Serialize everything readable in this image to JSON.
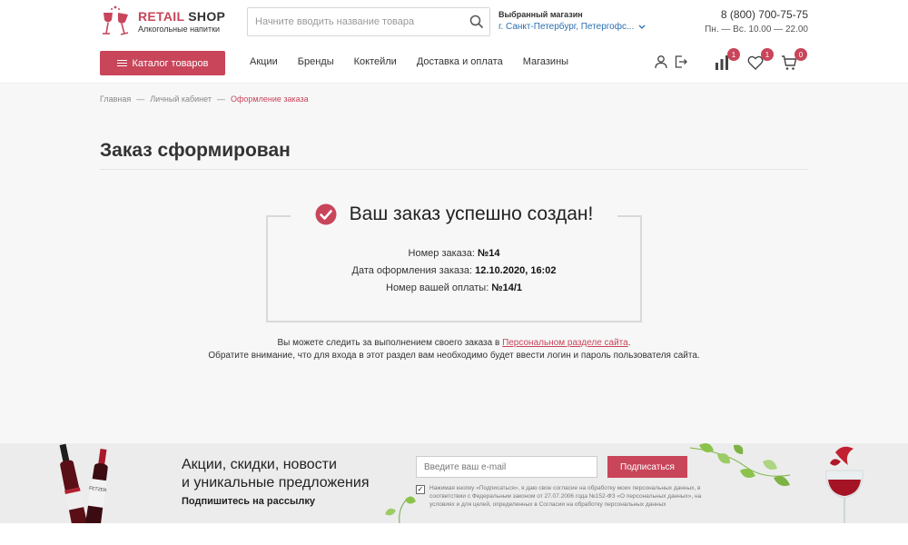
{
  "header": {
    "logo_title_accent": "RETAIL",
    "logo_title_rest": "SHOP",
    "logo_subtitle": "Алкогольные напитки",
    "search_placeholder": "Начните вводить название товара",
    "store_label": "Выбранный магазин",
    "store_value": "г. Санкт-Петербург, Петергофс...",
    "phone": "8 (800) 700-75-75",
    "hours": "Пн. — Вс. 10.00 — 22.00",
    "catalog_label": "Каталог товаров",
    "nav": [
      {
        "label": "Акции"
      },
      {
        "label": "Бренды"
      },
      {
        "label": "Коктейли"
      },
      {
        "label": "Доставка и оплата"
      },
      {
        "label": "Магазины"
      }
    ],
    "compare_count": "1",
    "favorites_count": "1",
    "cart_count": "0"
  },
  "breadcrumb": {
    "home": "Главная",
    "cabinet": "Личный кабинет",
    "current": "Оформление заказа"
  },
  "page": {
    "title": "Заказ сформирован",
    "success_title": "Ваш заказ успешно создан!",
    "order_number_label": "Номер заказа:",
    "order_number_value": "№14",
    "order_date_label": "Дата оформления заказа:",
    "order_date_value": "12.10.2020, 16:02",
    "payment_number_label": "Номер вашей оплаты:",
    "payment_number_value": "№14/1",
    "note_line1_before": "Вы можете следить за выполнением своего заказа в",
    "note_link": "Персональном разделе сайта",
    "note_line1_after": ".",
    "note_line2": "Обратите внимание, что для входа в этот раздел вам необходимо будет ввести логин и пароль пользователя сайта."
  },
  "banner": {
    "title_line1": "Акции, скидки, новости",
    "title_line2": "и уникальные предложения",
    "subtitle": "Подпишитесь на рассылку",
    "email_placeholder": "Введите ваш e-mail",
    "subscribe_label": "Подписаться",
    "consent_text": "Нажимая кнопку «Подписаться», я даю свое согласие на обработку моих персональных данных, в соответствии с Федеральным законом от 27.07.2006 года №152-ФЗ «О персональных данных», на условиях и для целей, определенных в Согласии на обработку персональных данных",
    "consent_checked": true
  },
  "colors": {
    "accent": "#c8455a",
    "link_blue": "#2a6fb0",
    "content_bg": "#f7f7f7",
    "banner_bg": "#ececec"
  },
  "icons": {
    "logo": "wine-glasses-icon",
    "search": "search-icon",
    "chevron": "chevron-down-icon",
    "burger": "burger-menu-icon",
    "user": "user-icon",
    "logout": "logout-icon",
    "compare": "compare-bars-icon",
    "favorites": "heart-icon",
    "cart": "cart-icon",
    "success": "check-circle-icon"
  }
}
